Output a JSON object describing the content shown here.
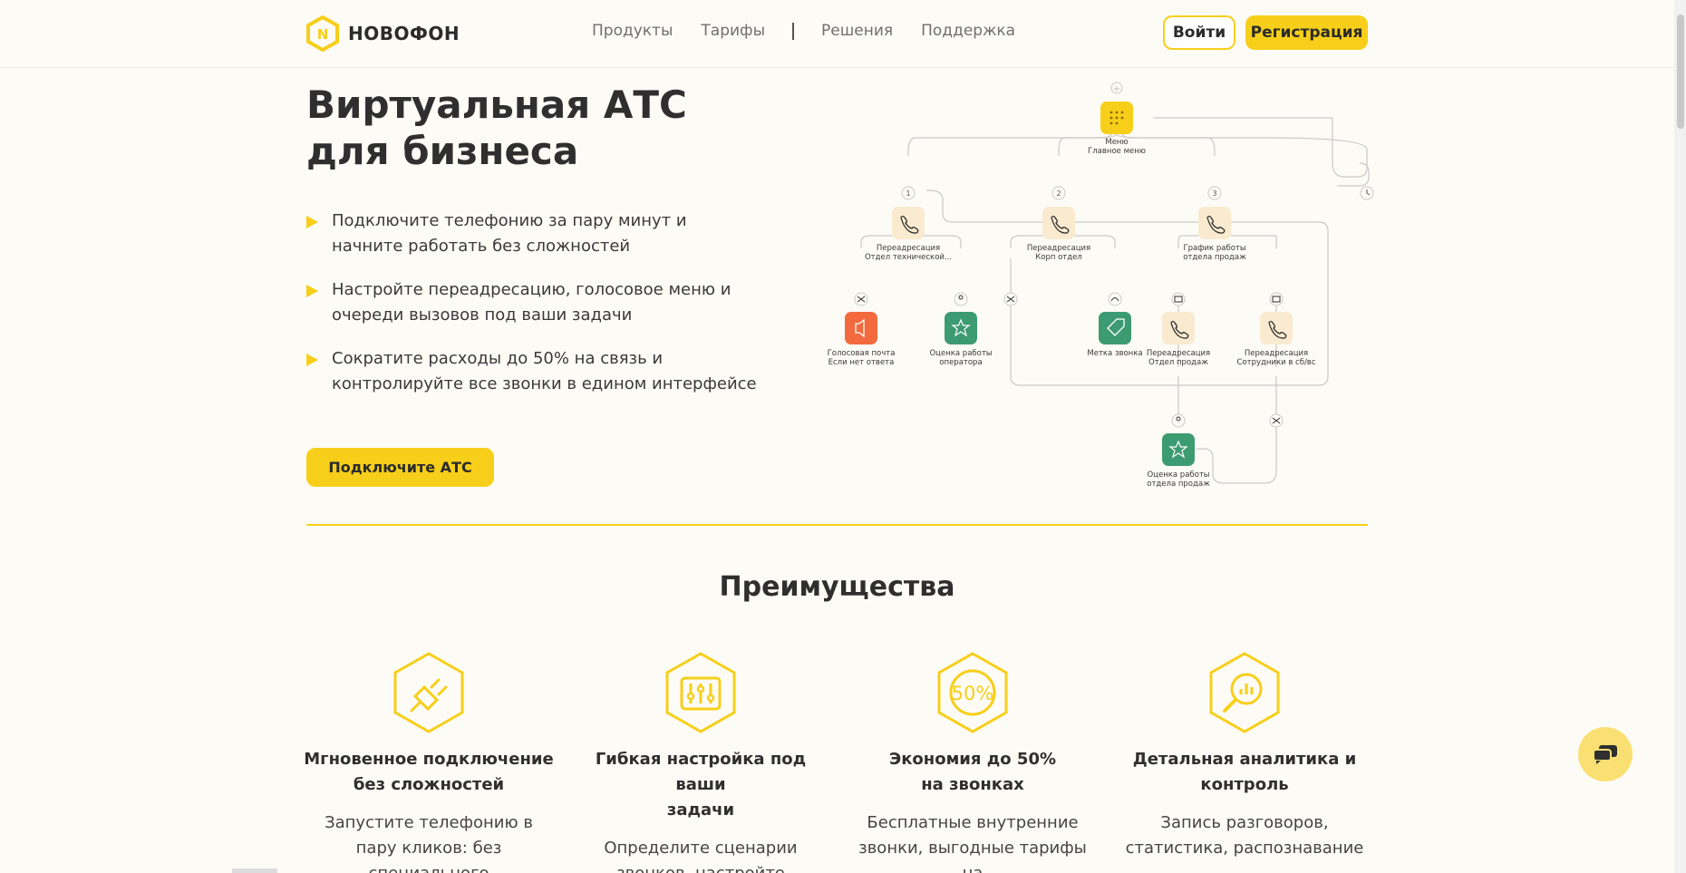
{
  "header": {
    "logo_text": "НОВОФОН",
    "nav": [
      "Продукты",
      "Тарифы",
      "Решения",
      "Поддержка"
    ],
    "login_label": "Войти",
    "register_label": "Регистрация"
  },
  "hero": {
    "title": "Виртуальная АТС для бизнеса",
    "bullets": [
      "Подключите телефонию за пару минут и начните работать без сложностей",
      "Настройте переадресацию, голосовое меню и очереди вызовов под ваши задачи",
      "Сократите расходы до 50% на связь и контролируйте все звонки в едином интерфейсе"
    ],
    "cta_label": "Подключите АТС"
  },
  "diagram": {
    "menu_title": "Меню",
    "menu_sub": "Главное меню",
    "branch_numbers": [
      "1",
      "2",
      "3"
    ],
    "fwd1_title": "Переадресация",
    "fwd1_sub": "Отдел технической...",
    "fwd2_title": "Переадресация",
    "fwd2_sub": "Корп отдел",
    "schedule_title": "График работы",
    "schedule_sub": "отдела продаж",
    "voicemail_title": "Голосовая почта",
    "voicemail_sub": "Если нет ответа",
    "rating1_title": "Оценка работы",
    "rating1_sub": "оператора",
    "tag_title": "Метка звонка",
    "fwd3_title": "Переадресация",
    "fwd3_sub": "Отдел продаж",
    "fwd4_title": "Переадресация",
    "fwd4_sub": "Сотрудники в сб/вс",
    "rating2_title": "Оценка работы",
    "rating2_sub": "отдела продаж"
  },
  "advantages": {
    "title": "Преимущества",
    "cards": [
      {
        "icon": "plug-icon",
        "title": "Мгновенное подключение\nбез сложностей",
        "text": "Запустите телефонию в пару кликов: без специального"
      },
      {
        "icon": "sliders-icon",
        "title": "Гибкая настройка под ваши\nзадачи",
        "text": "Определите сценарии звонков, настройте"
      },
      {
        "icon": "percent-icon",
        "title": "Экономия до 50%\nна звонках",
        "text": "Бесплатные внутренние звонки, выгодные тарифы на"
      },
      {
        "icon": "analytics-icon",
        "title": "Детальная аналитика и\nконтроль",
        "text": "Запись разговоров, статистика, распознавание"
      }
    ]
  },
  "icon_badge": "50%",
  "colors": {
    "accent": "#f7cf1a",
    "green": "#3d9b72",
    "red": "#f26a3d",
    "node_bg": "#f9ead0",
    "text": "#2f2f2f"
  }
}
